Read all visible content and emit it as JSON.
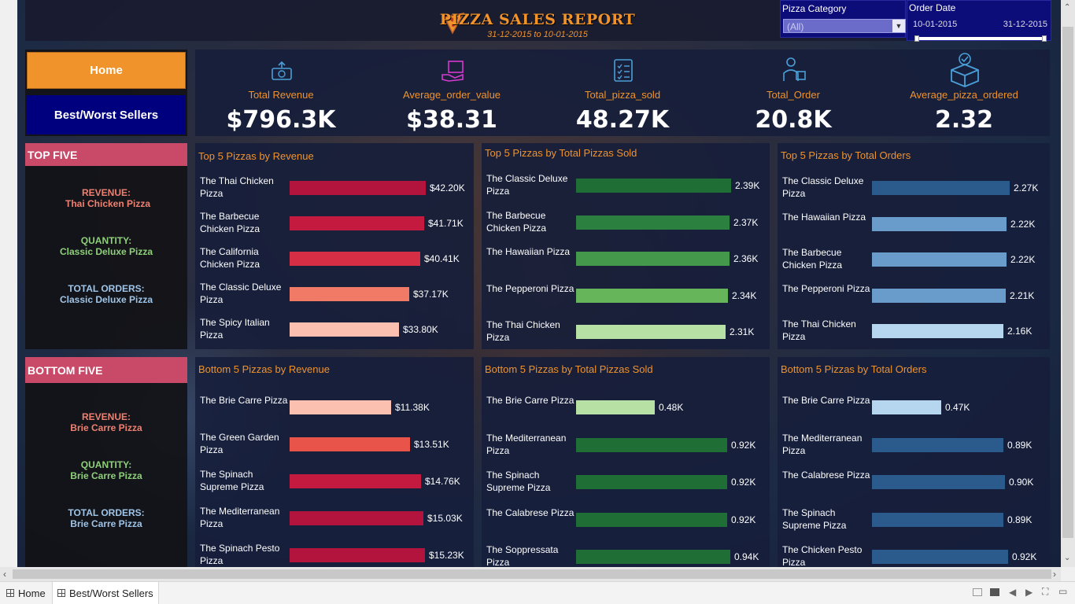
{
  "header": {
    "title": "PIZZA SALES REPORT",
    "date_range": "31-12-2015 to 10-01-2015",
    "icon": "pizza-icon"
  },
  "filters": {
    "category_label": "Pizza Category",
    "category_value": "(All)",
    "order_date_label": "Order Date",
    "date_start": "10-01-2015",
    "date_end": "31-12-2015"
  },
  "nav": {
    "home_label": "Home",
    "best_worst_label": "Best/Worst Sellers"
  },
  "kpis": [
    {
      "label": "Total Revenue",
      "value": "$796.3K",
      "icon": "money-icon"
    },
    {
      "label": "Average_order_value",
      "value": "$38.31",
      "icon": "hand-box-icon"
    },
    {
      "label": "Total_pizza_sold",
      "value": "48.27K",
      "icon": "checklist-icon"
    },
    {
      "label": "Total_Order",
      "value": "20.8K",
      "icon": "delivery-person-icon"
    },
    {
      "label": "Average_pizza_ordered",
      "value": "2.32",
      "icon": "package-check-icon"
    }
  ],
  "top_summary": {
    "tag": "TOP FIVE",
    "revenue_label": "REVENUE:",
    "revenue_value": "Thai Chicken Pizza",
    "quantity_label": "QUANTITY:",
    "quantity_value": "Classic Deluxe Pizza",
    "orders_label": "TOTAL ORDERS:",
    "orders_value": "Classic Deluxe Pizza"
  },
  "bottom_summary": {
    "tag": "BOTTOM FIVE",
    "revenue_label": "REVENUE:",
    "revenue_value": "Brie Carre Pizza",
    "quantity_label": "QUANTITY:",
    "quantity_value": "Brie Carre Pizza",
    "orders_label": "TOTAL ORDERS:",
    "orders_value": "Brie Carre Pizza"
  },
  "colors": {
    "accent": "#f0932b",
    "home_button": "#f0932b",
    "nav_button": "#00007f",
    "revenue_text": "#f08070",
    "quantity_text": "#8fd07a",
    "orders_text": "#9fc5e8"
  },
  "chart_data": [
    {
      "id": "top-revenue",
      "type": "bar",
      "orientation": "horizontal",
      "title": "Top 5 Pizzas by Revenue",
      "categories": [
        "The Thai Chicken Pizza",
        "The Barbecue Chicken Pizza",
        "The California Chicken Pizza",
        "The Classic Deluxe Pizza",
        "The Spicy Italian Pizza"
      ],
      "values": [
        42.2,
        41.71,
        40.41,
        37.17,
        33.8
      ],
      "labels": [
        "$42.20K",
        "$41.71K",
        "$40.41K",
        "$37.17K",
        "$33.80K"
      ],
      "colors": [
        "#b3143d",
        "#c41a40",
        "#d62e45",
        "#f07a66",
        "#fcc0b0"
      ]
    },
    {
      "id": "top-sold",
      "type": "bar",
      "orientation": "horizontal",
      "title": "Top 5 Pizzas by Total Pizzas Sold",
      "categories": [
        "The Classic Deluxe Pizza",
        "The Barbecue Chicken Pizza",
        "The Hawaiian Pizza",
        "The Pepperoni Pizza",
        "The Thai Chicken Pizza"
      ],
      "values": [
        2.39,
        2.37,
        2.36,
        2.34,
        2.31
      ],
      "labels": [
        "2.39K",
        "2.37K",
        "2.36K",
        "2.34K",
        "2.31K"
      ],
      "colors": [
        "#1f6e35",
        "#2b803f",
        "#43984c",
        "#66b55a",
        "#b7e0a5"
      ]
    },
    {
      "id": "top-orders",
      "type": "bar",
      "orientation": "horizontal",
      "title": "Top 5 Pizzas by Total Orders",
      "categories": [
        "The Classic Deluxe Pizza",
        "The Hawaiian Pizza",
        "The Barbecue Chicken Pizza",
        "The Pepperoni Pizza",
        "The Thai Chicken Pizza"
      ],
      "values": [
        2.27,
        2.22,
        2.22,
        2.21,
        2.16
      ],
      "labels": [
        "2.27K",
        "2.22K",
        "2.22K",
        "2.21K",
        "2.16K"
      ],
      "colors": [
        "#2b5b8c",
        "#6a9ccb",
        "#6a9ccb",
        "#6a9ccb",
        "#b5d6ee"
      ]
    },
    {
      "id": "bottom-revenue",
      "type": "bar",
      "orientation": "horizontal",
      "title": "Bottom 5 Pizzas by Revenue",
      "categories": [
        "The Brie Carre Pizza",
        "The Green Garden Pizza",
        "The Spinach Supreme Pizza",
        "The Mediterranean Pizza",
        "The Spinach Pesto Pizza"
      ],
      "values": [
        11.38,
        13.51,
        14.76,
        15.03,
        15.23
      ],
      "labels": [
        "$11.38K",
        "$13.51K",
        "$14.76K",
        "$15.03K",
        "$15.23K"
      ],
      "colors": [
        "#fcc0b0",
        "#e8544a",
        "#c41a40",
        "#b3143d",
        "#b3143d"
      ]
    },
    {
      "id": "bottom-sold",
      "type": "bar",
      "orientation": "horizontal",
      "title": "Bottom 5 Pizzas by Total Pizzas Sold",
      "categories": [
        "The Brie Carre Pizza",
        "The Mediterranean Pizza",
        "The Spinach Supreme Pizza",
        "The Calabrese Pizza",
        "The Soppressata Pizza"
      ],
      "values": [
        0.48,
        0.92,
        0.92,
        0.92,
        0.94
      ],
      "labels": [
        "0.48K",
        "0.92K",
        "0.92K",
        "0.92K",
        "0.94K"
      ],
      "colors": [
        "#b7e0a5",
        "#1f6e35",
        "#1f6e35",
        "#1f6e35",
        "#1f6e35"
      ]
    },
    {
      "id": "bottom-orders",
      "type": "bar",
      "orientation": "horizontal",
      "title": "Bottom 5 Pizzas by Total Orders",
      "categories": [
        "The Brie Carre Pizza",
        "The Mediterranean Pizza",
        "The Calabrese Pizza",
        "The Spinach Supreme Pizza",
        "The Chicken Pesto Pizza"
      ],
      "values": [
        0.47,
        0.89,
        0.9,
        0.89,
        0.92
      ],
      "labels": [
        "0.47K",
        "0.89K",
        "0.90K",
        "0.89K",
        "0.92K"
      ],
      "colors": [
        "#b5d6ee",
        "#2b5b8c",
        "#2b5b8c",
        "#2b5b8c",
        "#2b5b8c"
      ]
    }
  ],
  "tabs": [
    {
      "label": "Home",
      "active": false
    },
    {
      "label": "Best/Worst Sellers",
      "active": true
    }
  ]
}
